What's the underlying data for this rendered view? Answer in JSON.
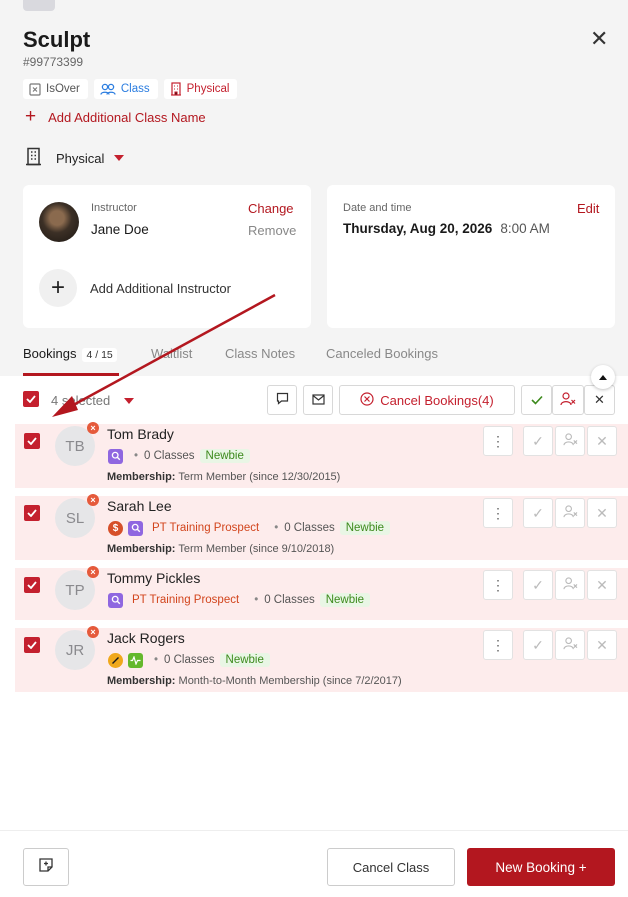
{
  "header": {
    "title": "Sculpt",
    "class_id": "#99773399",
    "tags": [
      {
        "label": "IsOver",
        "icon": "checkbox-x-icon"
      },
      {
        "label": "Class",
        "icon": "users-icon",
        "color": "#2b7de0"
      },
      {
        "label": "Physical",
        "icon": "building-icon",
        "color": "#c4202e"
      }
    ],
    "add_class_name_label": "Add Additional Class Name",
    "location": "Physical"
  },
  "instructor_card": {
    "label": "Instructor",
    "name": "Jane Doe",
    "change_label": "Change",
    "remove_label": "Remove",
    "add_label": "Add Additional Instructor"
  },
  "date_card": {
    "label": "Date and time",
    "date": "Thursday, Aug 20, 2026",
    "time": "8:00 AM",
    "edit_label": "Edit"
  },
  "tabs": [
    {
      "label": "Bookings",
      "count": "4 / 15",
      "active": true
    },
    {
      "label": "Waitlist"
    },
    {
      "label": "Class Notes"
    },
    {
      "label": "Canceled Bookings"
    }
  ],
  "toolbar": {
    "selected_text": "4 selected",
    "cancel_bookings_label": "Cancel Bookings(4)"
  },
  "bookings": [
    {
      "initials": "TB",
      "name": "Tom Brady",
      "badges": [
        "search"
      ],
      "prospect": "",
      "classes": "0 Classes",
      "status": "Newbie",
      "membership_label": "Membership:",
      "membership": "Term Member (since 12/30/2015)"
    },
    {
      "initials": "SL",
      "name": "Sarah Lee",
      "badges": [
        "dollar",
        "search"
      ],
      "prospect": "PT Training Prospect",
      "classes": "0 Classes",
      "status": "Newbie",
      "membership_label": "Membership:",
      "membership": "Term Member (since 9/10/2018)"
    },
    {
      "initials": "TP",
      "name": "Tommy Pickles",
      "badges": [
        "search"
      ],
      "prospect": "PT Training Prospect",
      "classes": "0 Classes",
      "status": "Newbie",
      "membership_label": "",
      "membership": ""
    },
    {
      "initials": "JR",
      "name": "Jack Rogers",
      "badges": [
        "pencil",
        "wave"
      ],
      "prospect": "",
      "classes": "0 Classes",
      "status": "Newbie",
      "membership_label": "Membership:",
      "membership": "Month-to-Month Membership (since 7/2/2017)"
    }
  ],
  "footer": {
    "cancel_class_label": "Cancel Class",
    "new_booking_label": "New Booking +"
  },
  "colors": {
    "accent": "#b3171f",
    "row_highlight": "#fdecec",
    "newbie": "#3d8a1d",
    "prospect": "#d2451d"
  }
}
